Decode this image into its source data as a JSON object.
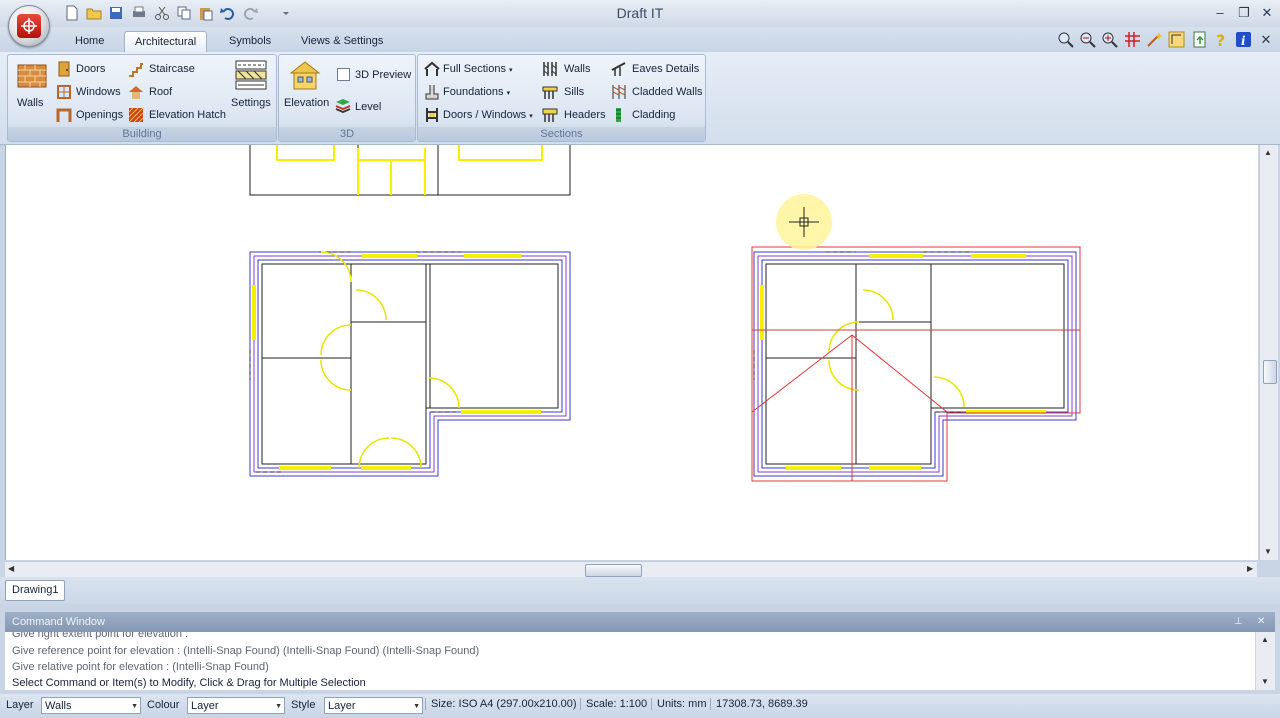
{
  "window": {
    "title": "Draft IT",
    "minimize": "–",
    "restore": "❐",
    "close": "✕"
  },
  "tabs": [
    {
      "label": "Home",
      "active": false
    },
    {
      "label": "Architectural",
      "active": true
    },
    {
      "label": "Symbols",
      "active": false
    },
    {
      "label": "Views & Settings",
      "active": false
    }
  ],
  "ribbon": {
    "building": {
      "label": "Building",
      "walls": "Walls",
      "doors": "Doors",
      "windows": "Windows",
      "openings": "Openings",
      "staircase": "Staircase",
      "roof": "Roof",
      "elevation_hatch": "Elevation Hatch",
      "settings": "Settings"
    },
    "three_d": {
      "label": "3D",
      "elevation": "Elevation",
      "preview": "3D Preview",
      "preview_checked": false,
      "level": "Level"
    },
    "sections": {
      "label": "Sections",
      "full_sections": "Full Sections",
      "foundations": "Foundations",
      "doors_windows": "Doors / Windows",
      "walls": "Walls",
      "sills": "Sills",
      "headers": "Headers",
      "eaves_details": "Eaves Details",
      "cladded_walls": "Cladded Walls",
      "cladding": "Cladding"
    }
  },
  "drawing_tab": "Drawing1",
  "command_window": {
    "title": "Command Window",
    "pin": "⊥",
    "close": "✕",
    "lines": [
      "Give right extent point for elevation :",
      "Give reference point for elevation :  (Intelli-Snap Found) (Intelli-Snap Found) (Intelli-Snap Found)",
      "Give relative point for elevation :  (Intelli-Snap Found)",
      "Select Command or Item(s) to Modify, Click & Drag for Multiple Selection"
    ]
  },
  "statusbar": {
    "layer_label": "Layer",
    "layer_value": "Walls",
    "colour_label": "Colour",
    "colour_value": "Layer",
    "style_label": "Style",
    "style_value": "Layer",
    "size": "Size: ISO A4 (297.00x210.00)",
    "scale": "Scale: 1:100",
    "units": "Units: mm",
    "coords": "17308.73, 8689.39"
  },
  "colors": {
    "wall_blue": "#3a3ad6",
    "wall_purple": "#8a3dc8",
    "window_yellow": "#f5f000",
    "door_yellow": "#e6e600",
    "elevation_red": "#e03a3a",
    "cursor_highlight": "#fff59a"
  }
}
